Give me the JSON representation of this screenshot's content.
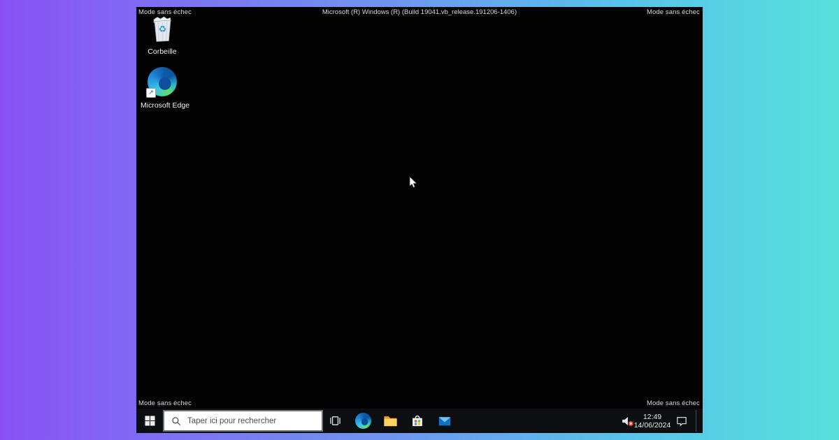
{
  "colors": {
    "bg-gradient-left": "#8a50f6",
    "bg-gradient-mid": "#6b9bee",
    "bg-gradient-right": "#57e0dc",
    "desktop-bg": "#020202",
    "taskbar-bg": "#0d0e11",
    "search-bg": "#ffffff",
    "search-text": "#4d4f54"
  },
  "desktop": {
    "safe_mode_label": "Mode sans échec",
    "build_label": "Microsoft (R) Windows (R) (Build 19041.vb_release.191206-1406)",
    "icons": [
      {
        "icon": "recycle-bin-icon",
        "label": "Corbeille"
      },
      {
        "icon": "edge-icon",
        "label": "Microsoft Edge"
      }
    ]
  },
  "taskbar": {
    "search_placeholder": "Taper ici pour rechercher",
    "icon_buttons": [
      "start-icon",
      "task-view-icon",
      "edge-icon",
      "file-explorer-icon",
      "store-icon",
      "mail-icon"
    ],
    "tray": {
      "volume_icon": "volume-muted-icon",
      "time": "12:49",
      "date": "14/06/2024",
      "action_center_icon": "action-center-bubble-icon"
    }
  }
}
